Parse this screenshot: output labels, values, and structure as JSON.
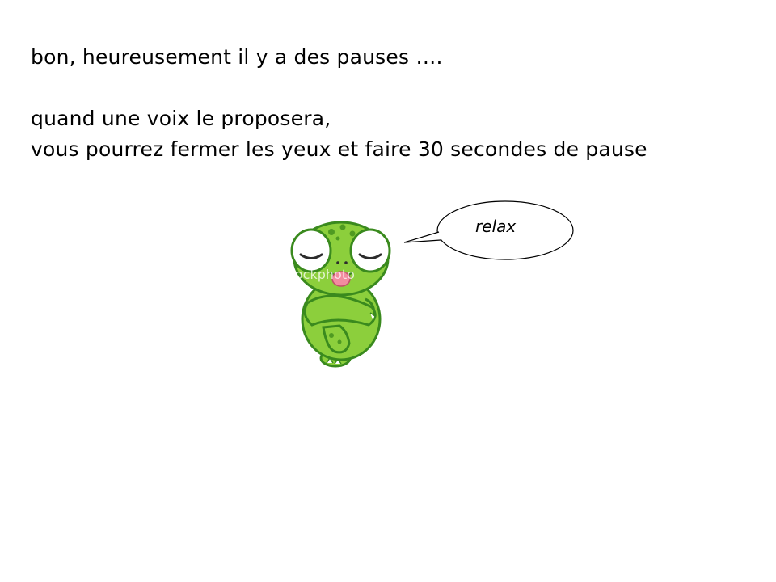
{
  "slide": {
    "lines": [
      "bon, heureusement il y a des pauses ….",
      "quand une voix le proposera,",
      "vous pourrez fermer les yeux et faire 30 secondes de pause"
    ],
    "bubble_text": "relax"
  },
  "illustration": {
    "subject": "turtle-icon",
    "watermark_text": "iStockphoto",
    "colors": {
      "body": "#8ccf3c",
      "outline": "#3a8a1e",
      "spots": "#4f9a22",
      "tongue": "#f28ca0"
    }
  }
}
